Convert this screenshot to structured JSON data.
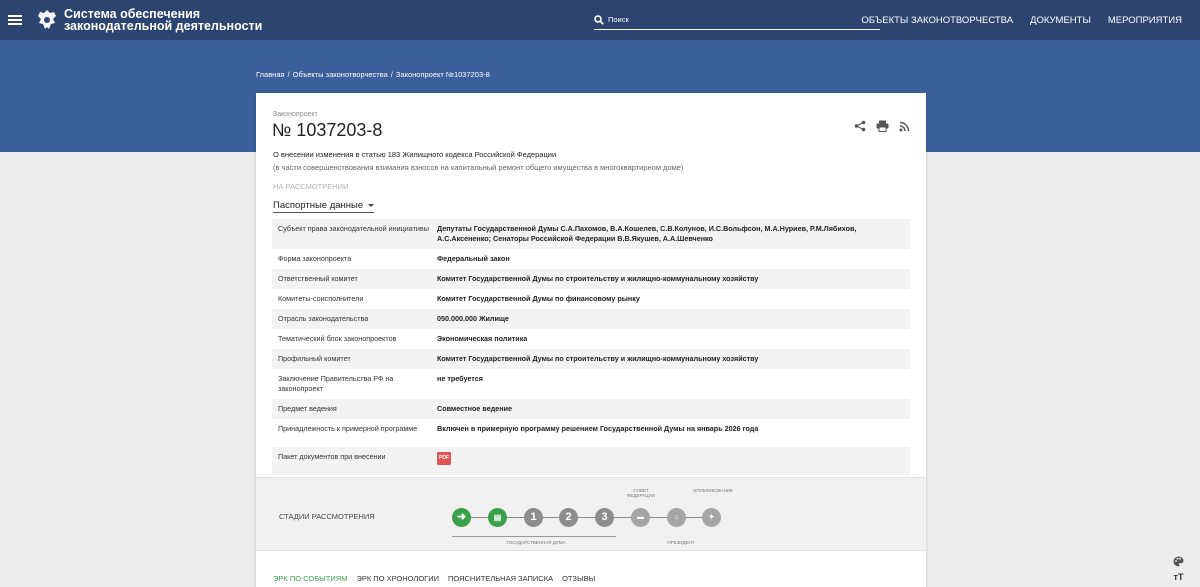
{
  "header": {
    "brand_line1": "Система обеспечения",
    "brand_line2": "законодательной деятельности",
    "search_placeholder": "Поиск",
    "nav": [
      "ОБЪЕКТЫ ЗАКОНОТВОРЧЕСТВА",
      "ДОКУМЕНТЫ",
      "МЕРОПРИЯТИЯ"
    ]
  },
  "breadcrumb": [
    "Главная",
    "Объекты законотворчества",
    "Законопроект №1037203-8"
  ],
  "bill": {
    "kind": "Законопроект",
    "number": "№ 1037203-8",
    "description": "О внесении изменения в статью 183 Жилищного кодекса Российской Федерации",
    "subdescription": "(в части совершенствования взимания взносов на капитальный ремонт общего имущества в многоквартирном доме)",
    "status": "НА РАССМОТРЕНИИ",
    "passport_label": "Паспортные данные"
  },
  "properties": [
    {
      "key": "Субъект права законодательной инициативы",
      "value": "Депутаты Государственной Думы С.А.Пахомов, В.А.Кошелев, С.В.Колунов, И.С.Вольфсон, М.А.Нуриев, Р.М.Лябихов, А.С.Аксененко; Сенаторы Российской Федерации В.В.Якушев, А.А.Шевченко"
    },
    {
      "key": "Форма законопроекта",
      "value": "Федеральный закон"
    },
    {
      "key": "Ответственный комитет",
      "value": "Комитет Государственной Думы по строительству и жилищно-коммунальному хозяйству"
    },
    {
      "key": "Комитеты-соисполнители",
      "value": "Комитет Государственной Думы по финансовому рынку"
    },
    {
      "key": "Отрасль законодательства",
      "value": "050.000.000 Жилище"
    },
    {
      "key": "Тематический блок законопроектов",
      "value": "Экономическая политика"
    },
    {
      "key": "Профильный комитет",
      "value": "Комитет Государственной Думы по строительству и жилищно-коммунальному хозяйству"
    },
    {
      "key": "Заключение Правительства РФ на законопроект",
      "value": "не требуется"
    },
    {
      "key": "Предмет ведения",
      "value": "Совместное ведение"
    },
    {
      "key": "Принадлежность к примерной программе",
      "value": "Включен в примерную программу решением Государственной Думы на январь 2026 года"
    },
    {
      "key": "Пакет документов при внесении",
      "value": "PDF"
    }
  ],
  "stages": {
    "label": "СТАДИИ РАССМОТРЕНИЯ",
    "numbers": [
      "1",
      "2",
      "3"
    ],
    "federation_council": "СОВЕТ ФЕДЕРАЦИИ",
    "publication": "ОПУБЛИКОВАНИЕ",
    "state_duma": "ГОСУДАРСТВЕННАЯ ДУМА",
    "president": "ПРЕЗИДЕНТ"
  },
  "tabs": [
    "ЭРК ПО СОБЫТИЯМ",
    "ЭРК ПО ХРОНОЛОГИИ",
    "ПОЯСНИТЕЛЬНАЯ ЗАПИСКА",
    "ОТЗЫВЫ"
  ],
  "corner": {
    "font_toggle": "тТ"
  },
  "colors": {
    "header": "#2d4470",
    "band": "#3b5f9a",
    "accent_green": "#3aa14a"
  }
}
